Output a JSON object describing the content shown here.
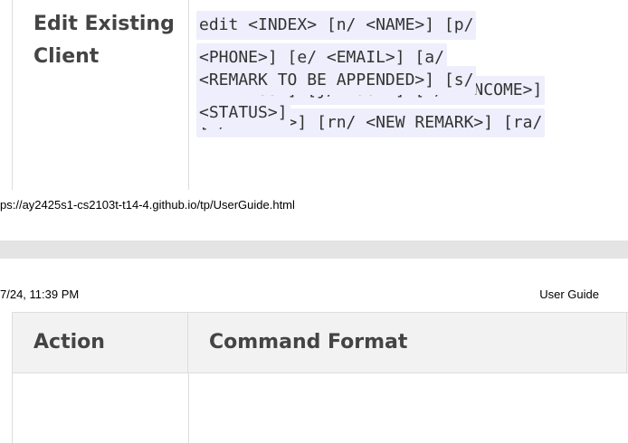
{
  "top_fragment": {
    "action_name": "Edit Existing Client",
    "command_lines": [
      "edit <INDEX> [n/ <NAME>] [p/",
      "<PHONE>] [e/ <EMAIL>] [a/",
      "<ADDRESS>] [j/ <JOB>] [i/ <INCOME>]",
      "[t/ <TIER>] [rn/ <NEW REMARK>] [ra/"
    ],
    "footer_url": "ps://ay2425s1-cs2103t-t14-4.github.io/tp/UserGuide.html"
  },
  "bottom_fragment": {
    "print_header_date": "7/24, 11:39 PM",
    "print_header_title": "User Guide",
    "table_headers": {
      "action": "Action",
      "command_format": "Command Format"
    },
    "command_lines": [
      "<REMARK TO BE APPENDED>] [s/",
      "<STATUS>]"
    ]
  },
  "colors": {
    "code_background": "#eeeefc",
    "header_background": "#f2f2f2",
    "border": "#dddddd",
    "page_gap": "#e4e4e4"
  }
}
